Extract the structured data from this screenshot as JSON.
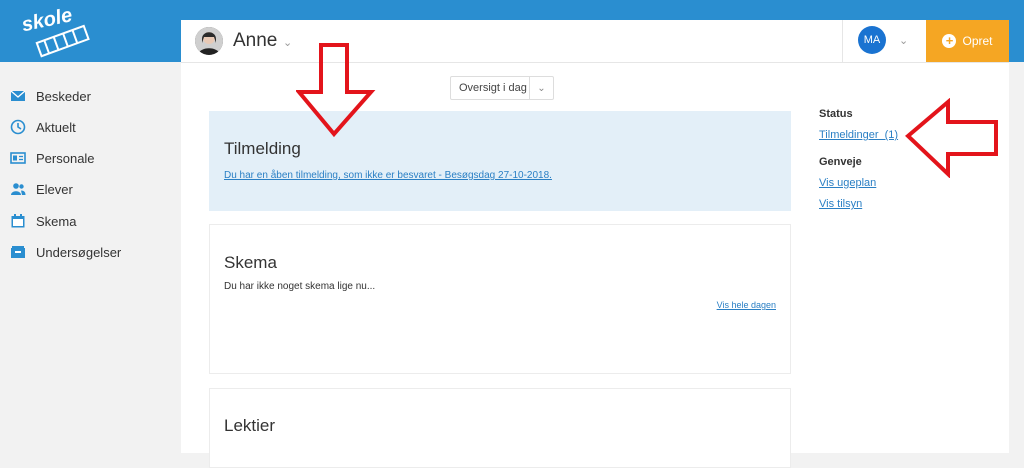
{
  "logo": {
    "text": "skole"
  },
  "sidebar": {
    "items": [
      {
        "label": "Beskeder",
        "icon": "envelope-icon"
      },
      {
        "label": "Aktuelt",
        "icon": "clock-icon"
      },
      {
        "label": "Personale",
        "icon": "id-card-icon"
      },
      {
        "label": "Elever",
        "icon": "users-icon"
      },
      {
        "label": "Skema",
        "icon": "calendar-icon"
      },
      {
        "label": "Undersøgelser",
        "icon": "inbox-icon"
      }
    ]
  },
  "header": {
    "user_name": "Anne",
    "account_initials": "MA",
    "create_label": "Opret"
  },
  "overview": {
    "selected": "Oversigt i dag"
  },
  "tilmelding": {
    "title": "Tilmelding",
    "link": "Du har en åben tilmelding, som ikke er besvaret - Besøgsdag 27-10-2018."
  },
  "skema": {
    "title": "Skema",
    "text": "Du har ikke noget skema lige nu...",
    "link": "Vis hele dagen"
  },
  "lektier": {
    "title": "Lektier"
  },
  "status": {
    "heading": "Status",
    "tilmeldinger": "Tilmeldinger  (1)"
  },
  "genveje": {
    "heading": "Genveje",
    "links": [
      "Vis ugeplan",
      "Vis tilsyn"
    ]
  },
  "colors": {
    "topbar": "#2a8ed0",
    "accent_orange": "#f5a623",
    "link_blue": "#2a7fc4",
    "annotation_red": "#e3141b"
  }
}
